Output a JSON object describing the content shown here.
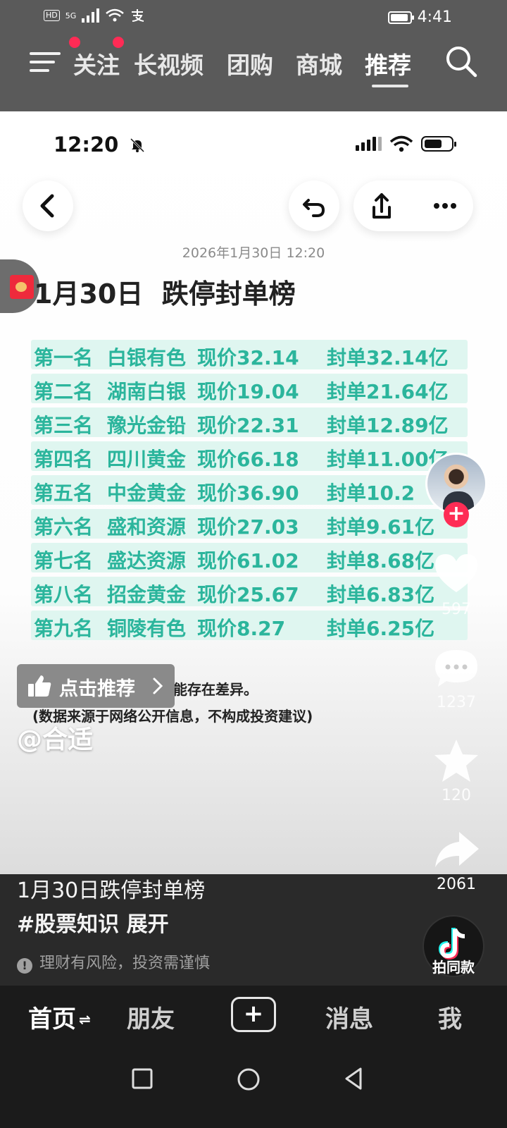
{
  "status_bar": {
    "network_left": "HD",
    "net_type": "5G",
    "time": "4:41"
  },
  "top_nav": {
    "tabs": [
      "关注",
      "长视频",
      "团购",
      "商城",
      "推荐"
    ],
    "active_tab": "推荐"
  },
  "post": {
    "inner_time": "12:20",
    "date_line": "2026年1月30日 12:20",
    "title": "1月30日  跌停封单榜",
    "ranking": [
      {
        "rank": "第一名",
        "name": "白银有色",
        "price": "现价32.14",
        "seal": "封单32.14亿"
      },
      {
        "rank": "第二名",
        "name": "湖南白银",
        "price": "现价19.04",
        "seal": "封单21.64亿"
      },
      {
        "rank": "第三名",
        "name": "豫光金铅",
        "price": "现价22.31",
        "seal": "封单12.89亿"
      },
      {
        "rank": "第四名",
        "name": "四川黄金",
        "price": "现价66.18",
        "seal": "封单11.00亿"
      },
      {
        "rank": "第五名",
        "name": "中金黄金",
        "price": "现价36.90",
        "seal": "封单10.2"
      },
      {
        "rank": "第六名",
        "name": "盛和资源",
        "price": "现价27.03",
        "seal": "封单9.61亿"
      },
      {
        "rank": "第七名",
        "name": "盛达资源",
        "price": "现价61.02",
        "seal": "封单8.68亿"
      },
      {
        "rank": "第八名",
        "name": "招金黄金",
        "price": "现价25.67",
        "seal": "封单6.83亿"
      },
      {
        "rank": "第九名",
        "name": "铜陵有色",
        "price": "现价8.27",
        "seal": "封单6.25亿"
      }
    ],
    "note1": "不同来源的挂单收据可能存在差异。",
    "note2": "(数据来源于网络公开信息，不构成投资建议)"
  },
  "recommend_button": "点击推荐",
  "author_handle": "@合适",
  "actions": {
    "likes": "597",
    "comments": "1237",
    "favorites": "120",
    "shares": "2061"
  },
  "caption": {
    "title": "1月30日跌停封单榜",
    "hashtag": "#股票知识",
    "expand": "展开",
    "risk_warning": "理财有风险，投资需谨慎"
  },
  "same_style_label": "拍同款",
  "bottom_tabs": {
    "home": "首页",
    "friends": "朋友",
    "plus": "+",
    "messages": "消息",
    "me": "我"
  }
}
